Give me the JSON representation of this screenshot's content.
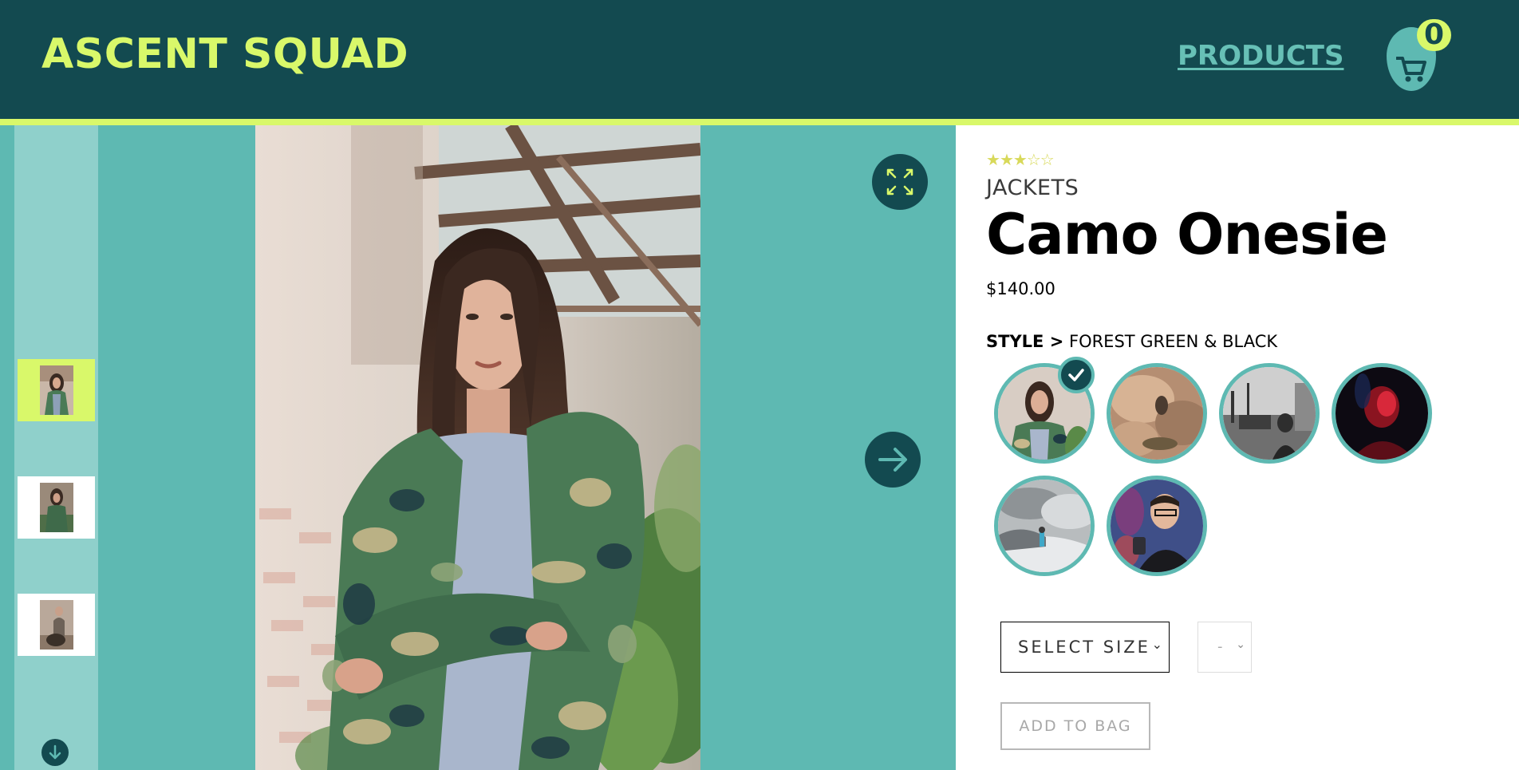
{
  "header": {
    "brand": "ASCENT SQUAD",
    "nav_products": "PRODUCTS",
    "cart_count": "0",
    "cart_icon": "shopping-cart-icon"
  },
  "gallery": {
    "thumbnails": [
      {
        "label": "woman-in-camo-jacket",
        "active": true
      },
      {
        "label": "woman-in-camo-jacket-2",
        "active": false
      },
      {
        "label": "person-with-dog",
        "active": false
      }
    ],
    "icons": {
      "expand": "expand-icon",
      "next": "arrow-right-icon",
      "rail_down": "arrow-down-icon"
    }
  },
  "product": {
    "rating": 3,
    "rating_max": 5,
    "category": "JACKETS",
    "title": "Camo Onesie",
    "price": "$140.00",
    "style_label": "STYLE >",
    "style_value": "FOREST GREEN & BLACK",
    "styles": [
      {
        "name": "forest-green-black",
        "selected": true
      },
      {
        "name": "rocks",
        "selected": false
      },
      {
        "name": "harbor",
        "selected": false
      },
      {
        "name": "red-neon",
        "selected": false
      },
      {
        "name": "snow-mountain",
        "selected": false
      },
      {
        "name": "graffiti",
        "selected": false
      }
    ],
    "size_select": "SELECT SIZE",
    "qty_select": "-",
    "add_to_bag": "ADD TO BAG"
  },
  "colors": {
    "header_bg": "#134a50",
    "accent": "#d9f86a",
    "teal": "#5eb9b2"
  }
}
